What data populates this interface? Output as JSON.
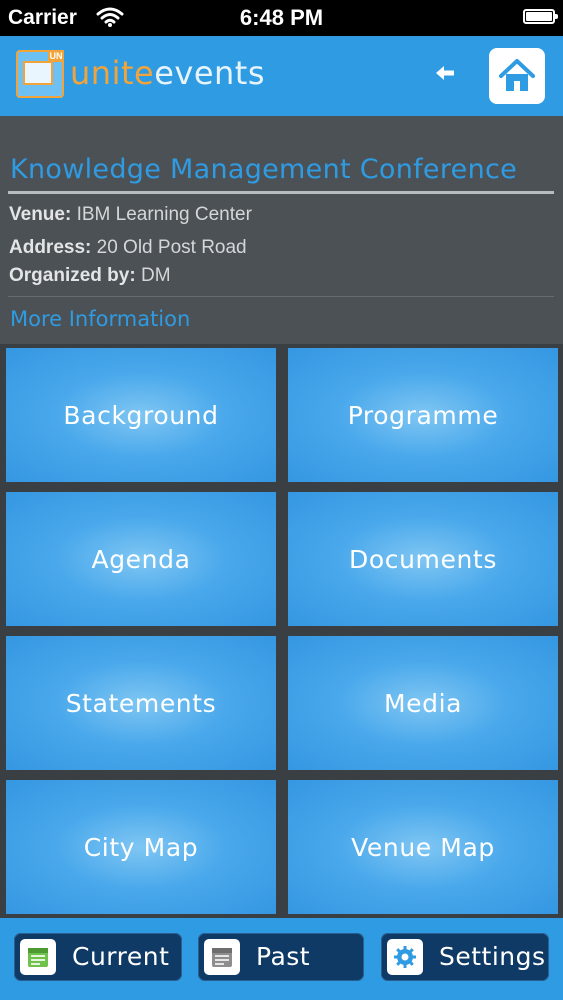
{
  "status_bar": {
    "carrier": "Carrier",
    "time": "6:48 PM"
  },
  "header": {
    "logo_badge": "UN",
    "logo_part1": "unite",
    "logo_part2": "events",
    "back_icon": "back-arrow-icon",
    "home_icon": "home-icon"
  },
  "event": {
    "title": "Knowledge Management Conference",
    "venue_label": "Venue:",
    "venue_value": "IBM Learning Center",
    "address_label": "Address:",
    "address_value": "20 Old Post Road",
    "organizer_label": "Organized by:",
    "organizer_value": "DM",
    "more_info": "More Information"
  },
  "tiles": [
    {
      "label": "Background"
    },
    {
      "label": "Programme"
    },
    {
      "label": "Agenda"
    },
    {
      "label": "Documents"
    },
    {
      "label": "Statements"
    },
    {
      "label": "Media"
    },
    {
      "label": "City Map"
    },
    {
      "label": "Venue Map"
    }
  ],
  "tab_bar": {
    "current": "Current",
    "past": "Past",
    "settings": "Settings"
  },
  "colors": {
    "accent_blue": "#2f9be2",
    "header_blue": "#2f9be2",
    "info_panel": "#4c5156",
    "tab_dark": "#0f3a66",
    "logo_orange": "#f2a43a"
  }
}
